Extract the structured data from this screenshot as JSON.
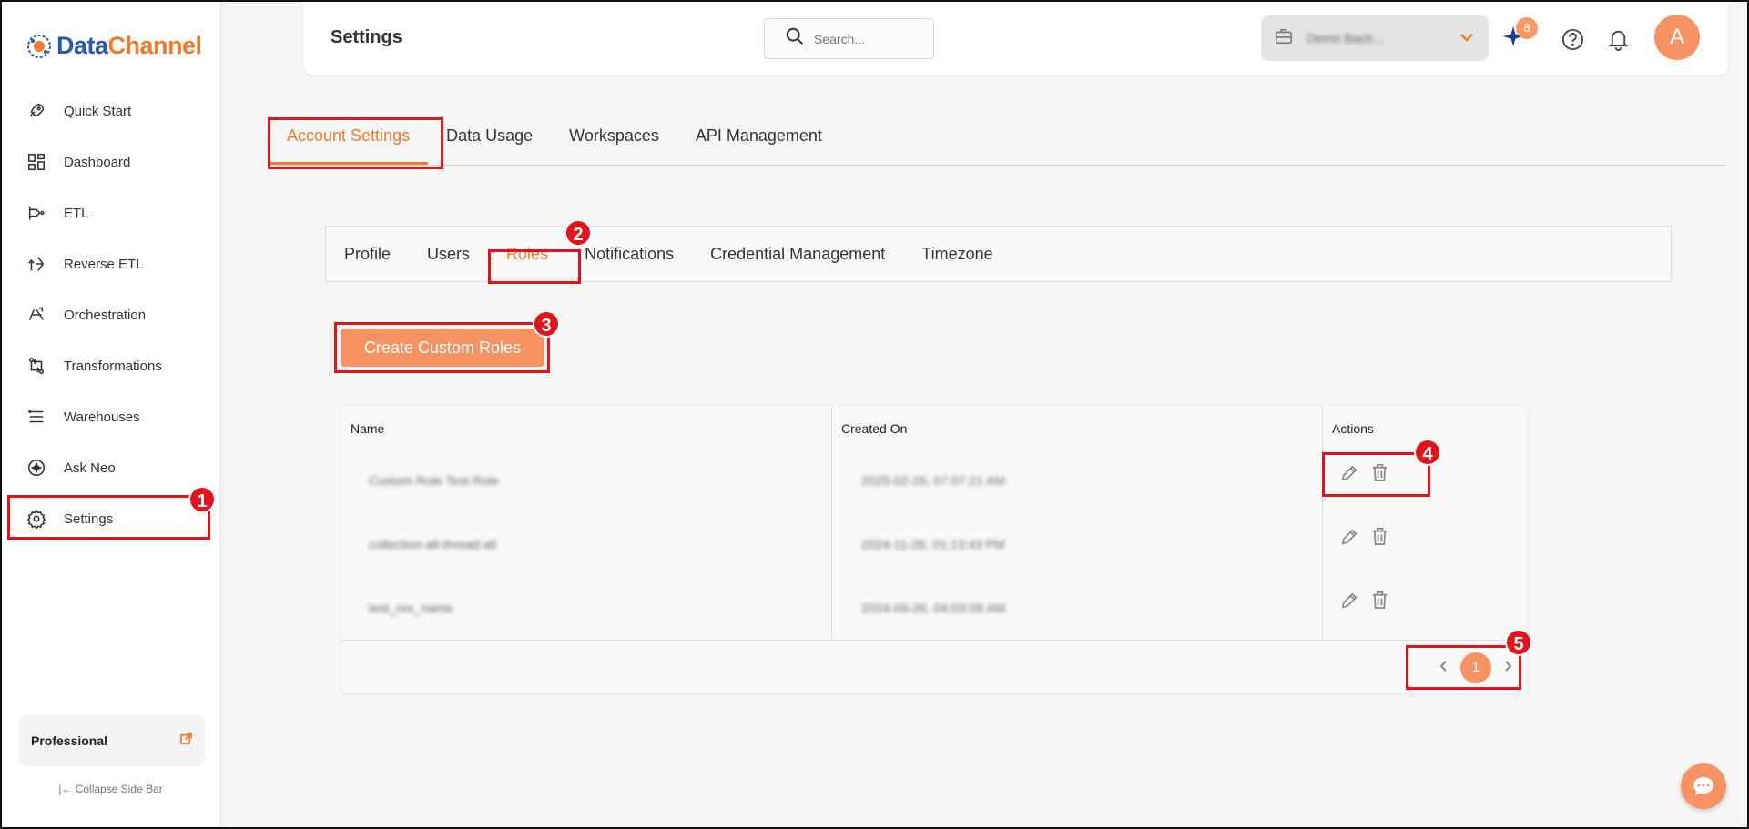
{
  "brand": {
    "part1": "Data",
    "part2": "Channel"
  },
  "sidebar": {
    "items": [
      {
        "label": "Quick Start",
        "icon": "rocket-icon"
      },
      {
        "label": "Dashboard",
        "icon": "dashboard-icon"
      },
      {
        "label": "ETL",
        "icon": "etl-icon"
      },
      {
        "label": "Reverse ETL",
        "icon": "reverse-etl-icon"
      },
      {
        "label": "Orchestration",
        "icon": "orchestration-icon"
      },
      {
        "label": "Transformations",
        "icon": "transformations-icon"
      },
      {
        "label": "Warehouses",
        "icon": "warehouses-icon"
      },
      {
        "label": "Ask Neo",
        "icon": "ask-neo-icon"
      },
      {
        "label": "Settings",
        "icon": "gear-icon"
      }
    ],
    "plan": "Professional",
    "collapse_label": "Collapse Side Bar"
  },
  "header": {
    "title": "Settings",
    "search_placeholder": "Search...",
    "workspace_name": "Demo Bach...",
    "notification_count": "8",
    "avatar_initial": "A"
  },
  "top_tabs": [
    "Account Settings",
    "Data Usage",
    "Workspaces",
    "API Management"
  ],
  "sub_tabs": [
    "Profile",
    "Users",
    "Roles",
    "Notifications",
    "Credential Management",
    "Timezone"
  ],
  "create_button": "Create Custom Roles",
  "table": {
    "headers": [
      "Name",
      "Created On",
      "Actions"
    ],
    "rows": [
      {
        "name": "Custom Role Test Role",
        "created": "2025-02-26, 07:07:21 AM"
      },
      {
        "name": "collection-all-thread-all",
        "created": "2024-11-26, 01:13:43 PM"
      },
      {
        "name": "test_rex_name",
        "created": "2024-09-26, 04:03:09 AM"
      }
    ]
  },
  "pagination": {
    "current_page": "1"
  },
  "markers": [
    "1",
    "2",
    "3",
    "4",
    "5"
  ],
  "colors": {
    "accent": "#f79263",
    "highlight": "#e0141c",
    "brand_blue": "#2a5ba8"
  }
}
